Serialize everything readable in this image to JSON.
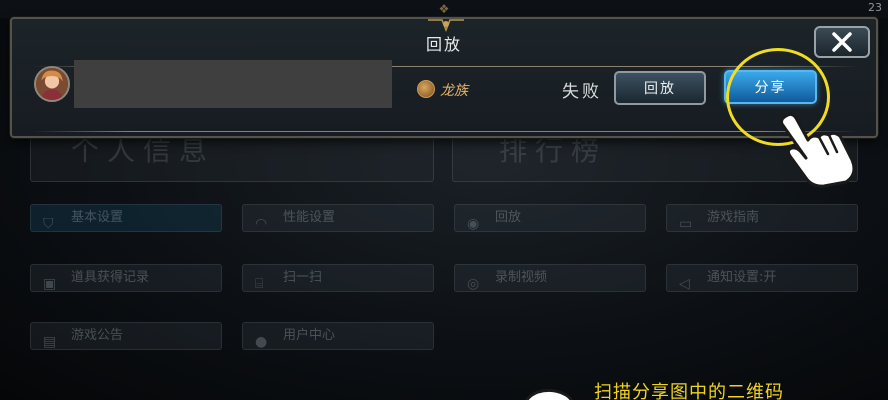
{
  "status_bar": {
    "clock": "23"
  },
  "background_menu": {
    "panels": [
      {
        "title": "个人信息"
      },
      {
        "title": "排行榜"
      }
    ],
    "buttons": [
      {
        "label": "基本设置",
        "icon": "shield-icon"
      },
      {
        "label": "性能设置",
        "icon": "gauge-icon"
      },
      {
        "label": "回放",
        "icon": "replay-icon"
      },
      {
        "label": "游戏指南",
        "icon": "book-icon"
      },
      {
        "label": "道具获得记录",
        "icon": "items-icon"
      },
      {
        "label": "扫一扫",
        "icon": "scan-icon"
      },
      {
        "label": "录制视频",
        "icon": "record-icon"
      },
      {
        "label": "通知设置:开",
        "icon": "speaker-icon"
      },
      {
        "label": "游戏公告",
        "icon": "notice-icon"
      },
      {
        "label": "用户中心",
        "icon": "user-icon"
      }
    ]
  },
  "dialog": {
    "title": "回放",
    "player": {
      "avatar": "player-avatar",
      "race": "龙族",
      "result": "失败"
    },
    "buttons": {
      "replay": "回放",
      "share": "分享"
    }
  },
  "tutorial": {
    "caption": "扫描分享图中的二维码",
    "highlight_color": "#f0dc24",
    "pointer_icon": "pointing-hand-icon"
  },
  "colors": {
    "share_button": "#2a8fd6",
    "race_label": "#e7b468",
    "caption": "#f0d320"
  }
}
